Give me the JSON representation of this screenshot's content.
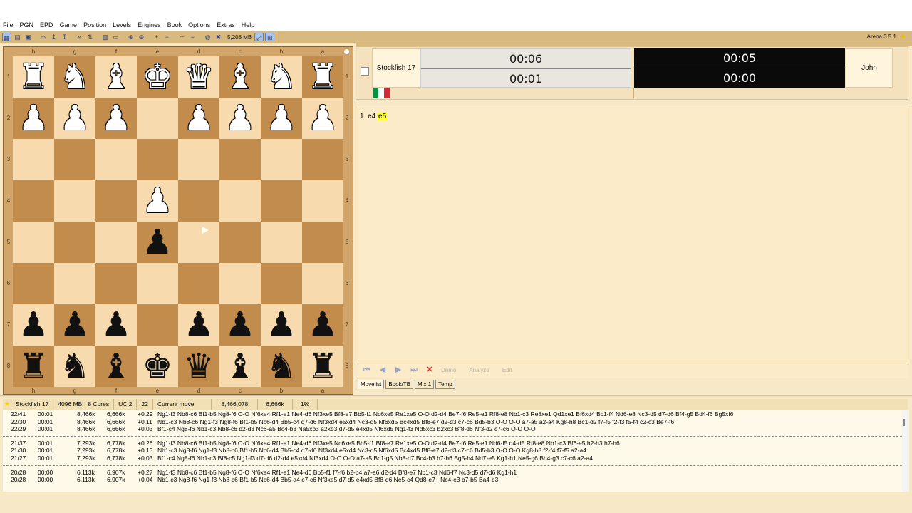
{
  "menu": [
    "File",
    "PGN",
    "EPD",
    "Game",
    "Position",
    "Levels",
    "Engines",
    "Book",
    "Options",
    "Extras",
    "Help"
  ],
  "toolbar": {
    "memory": "5,208 MB",
    "version": "Arena 3.5.1"
  },
  "board": {
    "files": [
      "h",
      "g",
      "f",
      "e",
      "d",
      "c",
      "b",
      "a"
    ],
    "ranks": [
      "1",
      "2",
      "3",
      "4",
      "5",
      "6",
      "7",
      "8"
    ],
    "squares": [
      [
        {
          "p": "♜",
          "c": "w",
          "n": "white-rook"
        },
        {
          "p": "♞",
          "c": "w",
          "n": "white-knight"
        },
        {
          "p": "♝",
          "c": "w",
          "n": "white-bishop"
        },
        {
          "p": "♚",
          "c": "w",
          "n": "white-king"
        },
        {
          "p": "♛",
          "c": "w",
          "n": "white-queen"
        },
        {
          "p": "♝",
          "c": "w",
          "n": "white-bishop"
        },
        {
          "p": "♞",
          "c": "w",
          "n": "white-knight"
        },
        {
          "p": "♜",
          "c": "w",
          "n": "white-rook"
        }
      ],
      [
        {
          "p": "♟",
          "c": "w",
          "n": "white-pawn"
        },
        {
          "p": "♟",
          "c": "w",
          "n": "white-pawn"
        },
        {
          "p": "♟",
          "c": "w",
          "n": "white-pawn"
        },
        {
          "p": "",
          "c": "",
          "n": "empty"
        },
        {
          "p": "♟",
          "c": "w",
          "n": "white-pawn"
        },
        {
          "p": "♟",
          "c": "w",
          "n": "white-pawn"
        },
        {
          "p": "♟",
          "c": "w",
          "n": "white-pawn"
        },
        {
          "p": "♟",
          "c": "w",
          "n": "white-pawn"
        }
      ],
      [
        {
          "p": "",
          "c": "",
          "n": "empty"
        },
        {
          "p": "",
          "c": "",
          "n": "empty"
        },
        {
          "p": "",
          "c": "",
          "n": "empty"
        },
        {
          "p": "",
          "c": "",
          "n": "empty"
        },
        {
          "p": "",
          "c": "",
          "n": "empty"
        },
        {
          "p": "",
          "c": "",
          "n": "empty"
        },
        {
          "p": "",
          "c": "",
          "n": "empty"
        },
        {
          "p": "",
          "c": "",
          "n": "empty"
        }
      ],
      [
        {
          "p": "",
          "c": "",
          "n": "empty"
        },
        {
          "p": "",
          "c": "",
          "n": "empty"
        },
        {
          "p": "",
          "c": "",
          "n": "empty"
        },
        {
          "p": "♟",
          "c": "w",
          "n": "white-pawn"
        },
        {
          "p": "",
          "c": "",
          "n": "empty"
        },
        {
          "p": "",
          "c": "",
          "n": "empty"
        },
        {
          "p": "",
          "c": "",
          "n": "empty"
        },
        {
          "p": "",
          "c": "",
          "n": "empty"
        }
      ],
      [
        {
          "p": "",
          "c": "",
          "n": "empty"
        },
        {
          "p": "",
          "c": "",
          "n": "empty"
        },
        {
          "p": "",
          "c": "",
          "n": "empty"
        },
        {
          "p": "♟",
          "c": "b",
          "n": "black-pawn"
        },
        {
          "p": "",
          "c": "",
          "n": "empty"
        },
        {
          "p": "",
          "c": "",
          "n": "empty"
        },
        {
          "p": "",
          "c": "",
          "n": "empty"
        },
        {
          "p": "",
          "c": "",
          "n": "empty"
        }
      ],
      [
        {
          "p": "",
          "c": "",
          "n": "empty"
        },
        {
          "p": "",
          "c": "",
          "n": "empty"
        },
        {
          "p": "",
          "c": "",
          "n": "empty"
        },
        {
          "p": "",
          "c": "",
          "n": "empty"
        },
        {
          "p": "",
          "c": "",
          "n": "empty"
        },
        {
          "p": "",
          "c": "",
          "n": "empty"
        },
        {
          "p": "",
          "c": "",
          "n": "empty"
        },
        {
          "p": "",
          "c": "",
          "n": "empty"
        }
      ],
      [
        {
          "p": "♟",
          "c": "b",
          "n": "black-pawn"
        },
        {
          "p": "♟",
          "c": "b",
          "n": "black-pawn"
        },
        {
          "p": "♟",
          "c": "b",
          "n": "black-pawn"
        },
        {
          "p": "",
          "c": "",
          "n": "empty"
        },
        {
          "p": "♟",
          "c": "b",
          "n": "black-pawn"
        },
        {
          "p": "♟",
          "c": "b",
          "n": "black-pawn"
        },
        {
          "p": "♟",
          "c": "b",
          "n": "black-pawn"
        },
        {
          "p": "♟",
          "c": "b",
          "n": "black-pawn"
        }
      ],
      [
        {
          "p": "♜",
          "c": "b",
          "n": "black-rook"
        },
        {
          "p": "♞",
          "c": "b",
          "n": "black-knight"
        },
        {
          "p": "♝",
          "c": "b",
          "n": "black-bishop"
        },
        {
          "p": "♚",
          "c": "b",
          "n": "black-king"
        },
        {
          "p": "♛",
          "c": "b",
          "n": "black-queen"
        },
        {
          "p": "♝",
          "c": "b",
          "n": "black-bishop"
        },
        {
          "p": "♞",
          "c": "b",
          "n": "black-knight"
        },
        {
          "p": "♜",
          "c": "b",
          "n": "black-rook"
        }
      ]
    ],
    "light_color": "#f7dbae",
    "dark_color": "#c18c4c"
  },
  "clocks": {
    "engine_name": "Stockfish 17",
    "white_total": "00:06",
    "white_move": "00:01",
    "black_total": "00:05",
    "black_move": "00:00",
    "player_name": "John",
    "flag_colors": [
      "#009246",
      "#ffffff",
      "#ce2b37"
    ]
  },
  "notation": {
    "move_prefix": "1. e4",
    "last_move": "e5"
  },
  "nav": {
    "demo": "Demo",
    "analyze": "Analyze",
    "edit": "Edit"
  },
  "tabs": [
    "Movelist",
    "Book/TB",
    "Mix 1",
    "Temp"
  ],
  "analysis_header": {
    "engine": "Stockfish 17",
    "hash": "4096 MB",
    "cores": "8 Cores",
    "protocol": "UCI2",
    "depth": "22",
    "current_move": "Current move",
    "nodes": "8,466,078",
    "nps": "6,666k",
    "percent": "1%"
  },
  "analysis_groups": [
    [
      {
        "d": "22/41",
        "t": "00:01",
        "n": "8,466k",
        "s": "6,666k",
        "e": "+0.29",
        "p": "Ng1-f3  Nb8-c6  Bf1-b5  Ng8-f6  O-O  Nf6xe4  Rf1-e1  Ne4-d6  Nf3xe5  Bf8-e7  Bb5-f1  Nc6xe5  Re1xe5  O-O  d2-d4  Be7-f6  Re5-e1  Rf8-e8  Nb1-c3  Re8xe1  Qd1xe1  Bf6xd4  Bc1-f4  Nd6-e8  Nc3-d5  d7-d6  Bf4-g5  Bd4-f6  Bg5xf6"
      },
      {
        "d": "22/30",
        "t": "00:01",
        "n": "8,466k",
        "s": "6,666k",
        "e": "+0.11",
        "p": "Nb1-c3  Nb8-c6  Ng1-f3  Ng8-f6  Bf1-b5  Nc6-d4  Bb5-c4  d7-d6  Nf3xd4  e5xd4  Nc3-d5  Nf6xd5  Bc4xd5  Bf8-e7  d2-d3  c7-c6  Bd5-b3  O-O  O-O  a7-a5  a2-a4  Kg8-h8  Bc1-d2  f7-f5  f2-f3  f5-f4  c2-c3  Be7-f6"
      },
      {
        "d": "22/29",
        "t": "00:01",
        "n": "8,466k",
        "s": "6,666k",
        "e": "+0.03",
        "p": "Bf1-c4  Ng8-f6  Nb1-c3  Nb8-c6  d2-d3  Nc6-a5  Bc4-b3  Na5xb3  a2xb3  d7-d5  e4xd5  Nf6xd5  Ng1-f3  Nd5xc3  b2xc3  Bf8-d6  Nf3-d2  c7-c6  O-O  O-O"
      }
    ],
    [
      {
        "d": "21/37",
        "t": "00:01",
        "n": "7,293k",
        "s": "6,778k",
        "e": "+0.26",
        "p": "Ng1-f3  Nb8-c6  Bf1-b5  Ng8-f6  O-O  Nf6xe4  Rf1-e1  Ne4-d6  Nf3xe5  Nc6xe5  Bb5-f1  Bf8-e7  Re1xe5  O-O  d2-d4  Be7-f6  Re5-e1  Nd6-f5  d4-d5  Rf8-e8  Nb1-c3  Bf6-e5  h2-h3  h7-h6"
      },
      {
        "d": "21/30",
        "t": "00:01",
        "n": "7,293k",
        "s": "6,778k",
        "e": "+0.13",
        "p": "Nb1-c3  Ng8-f6  Ng1-f3  Nb8-c6  Bf1-b5  Nc6-d4  Bb5-c4  d7-d6  Nf3xd4  e5xd4  Nc3-d5  Nf6xd5  Bc4xd5  Bf8-e7  d2-d3  c7-c6  Bd5-b3  O-O  O-O  Kg8-h8  f2-f4  f7-f5  a2-a4"
      },
      {
        "d": "21/27",
        "t": "00:01",
        "n": "7,293k",
        "s": "6,778k",
        "e": "+0.03",
        "p": "Bf1-c4  Ng8-f6  Nb1-c3  Bf8-c5  Ng1-f3  d7-d6  d2-d4  e5xd4  Nf3xd4  O-O  O-O  a7-a5  Bc1-g5  Nb8-d7  Bc4-b3  h7-h6  Bg5-h4  Nd7-e5  Kg1-h1  Ne5-g6  Bh4-g3  c7-c6  a2-a4"
      }
    ],
    [
      {
        "d": "20/28",
        "t": "00:00",
        "n": "6,113k",
        "s": "6,907k",
        "e": "+0.27",
        "p": "Ng1-f3  Nb8-c6  Bf1-b5  Ng8-f6  O-O  Nf6xe4  Rf1-e1  Ne4-d6  Bb5-f1  f7-f6  b2-b4  a7-a6  d2-d4  Bf8-e7  Nb1-c3  Nd6-f7  Nc3-d5  d7-d6  Kg1-h1"
      },
      {
        "d": "20/28",
        "t": "00:00",
        "n": "6,113k",
        "s": "6,907k",
        "e": "+0.04",
        "p": "Nb1-c3  Ng8-f6  Ng1-f3  Nb8-c6  Bf1-b5  Nc6-d4  Bb5-a4  c7-c6  Nf3xe5  d7-d5  e4xd5  Bf8-d6  Ne5-c4  Qd8-e7+  Nc4-e3  b7-b5  Ba4-b3"
      }
    ]
  ]
}
